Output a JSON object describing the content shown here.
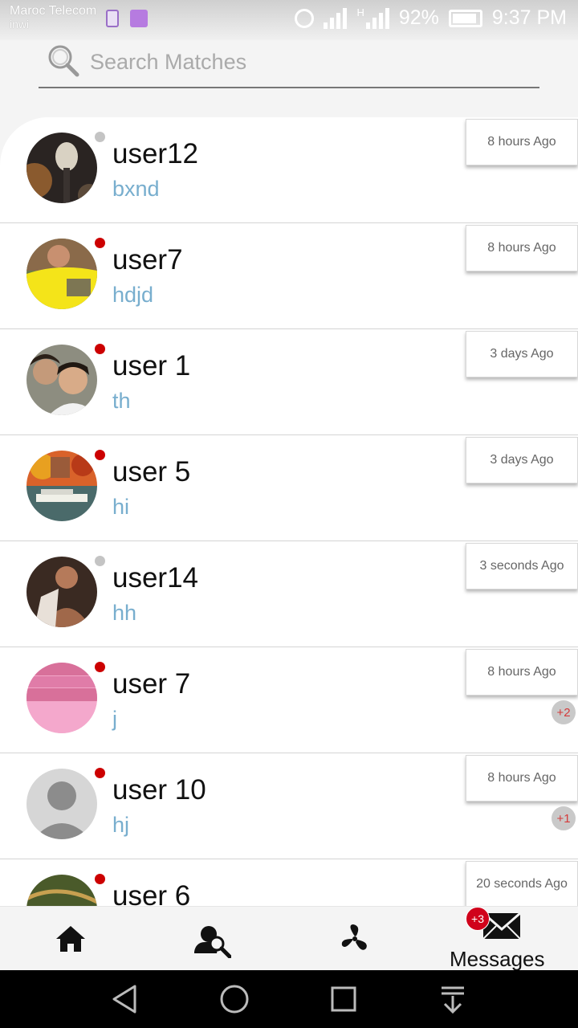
{
  "status_bar": {
    "carrier_primary": "Maroc Telecom",
    "carrier_secondary": "inwi",
    "network_type": "H",
    "battery_percent": "92%",
    "time": "9:37 PM"
  },
  "search": {
    "placeholder": "Search Matches",
    "value": ""
  },
  "conversations": [
    {
      "name": "user12",
      "message": "bxnd",
      "time": "8 hours Ago",
      "online": false,
      "unread": "",
      "avatar": "spoon-photo"
    },
    {
      "name": "user7",
      "message": " hdjd",
      "time": "8 hours Ago",
      "online": true,
      "unread": "",
      "avatar": "yellow-shirt-photo"
    },
    {
      "name": "user 1",
      "message": "th",
      "time": "3 days Ago",
      "online": true,
      "unread": "",
      "avatar": "two-people-photo"
    },
    {
      "name": "user 5",
      "message": " hi",
      "time": "3 days Ago",
      "online": true,
      "unread": "",
      "avatar": "river-boat-photo"
    },
    {
      "name": "user14",
      "message": "hh",
      "time": "3 seconds Ago",
      "online": false,
      "unread": "",
      "avatar": "man-portrait-photo"
    },
    {
      "name": "user 7",
      "message": "j",
      "time": "8 hours Ago",
      "online": true,
      "unread": "+2",
      "avatar": "pink-screenshot-photo"
    },
    {
      "name": "user 10",
      "message": " hj",
      "time": "8 hours Ago",
      "online": true,
      "unread": "+1",
      "avatar": "default-avatar"
    },
    {
      "name": "user 6",
      "message": "",
      "time": "20 seconds Ago",
      "online": true,
      "unread": "",
      "avatar": "nature-photo"
    }
  ],
  "bottom_nav": {
    "home_icon": "home-icon",
    "search_icon": "person-search-icon",
    "fan_icon": "fan-icon",
    "messages_label": "Messages",
    "messages_badge": "+3"
  },
  "colors": {
    "online": "#cc0000",
    "offline": "#c4c4c4",
    "message_text": "#78aece",
    "badge": "#d0021b"
  }
}
